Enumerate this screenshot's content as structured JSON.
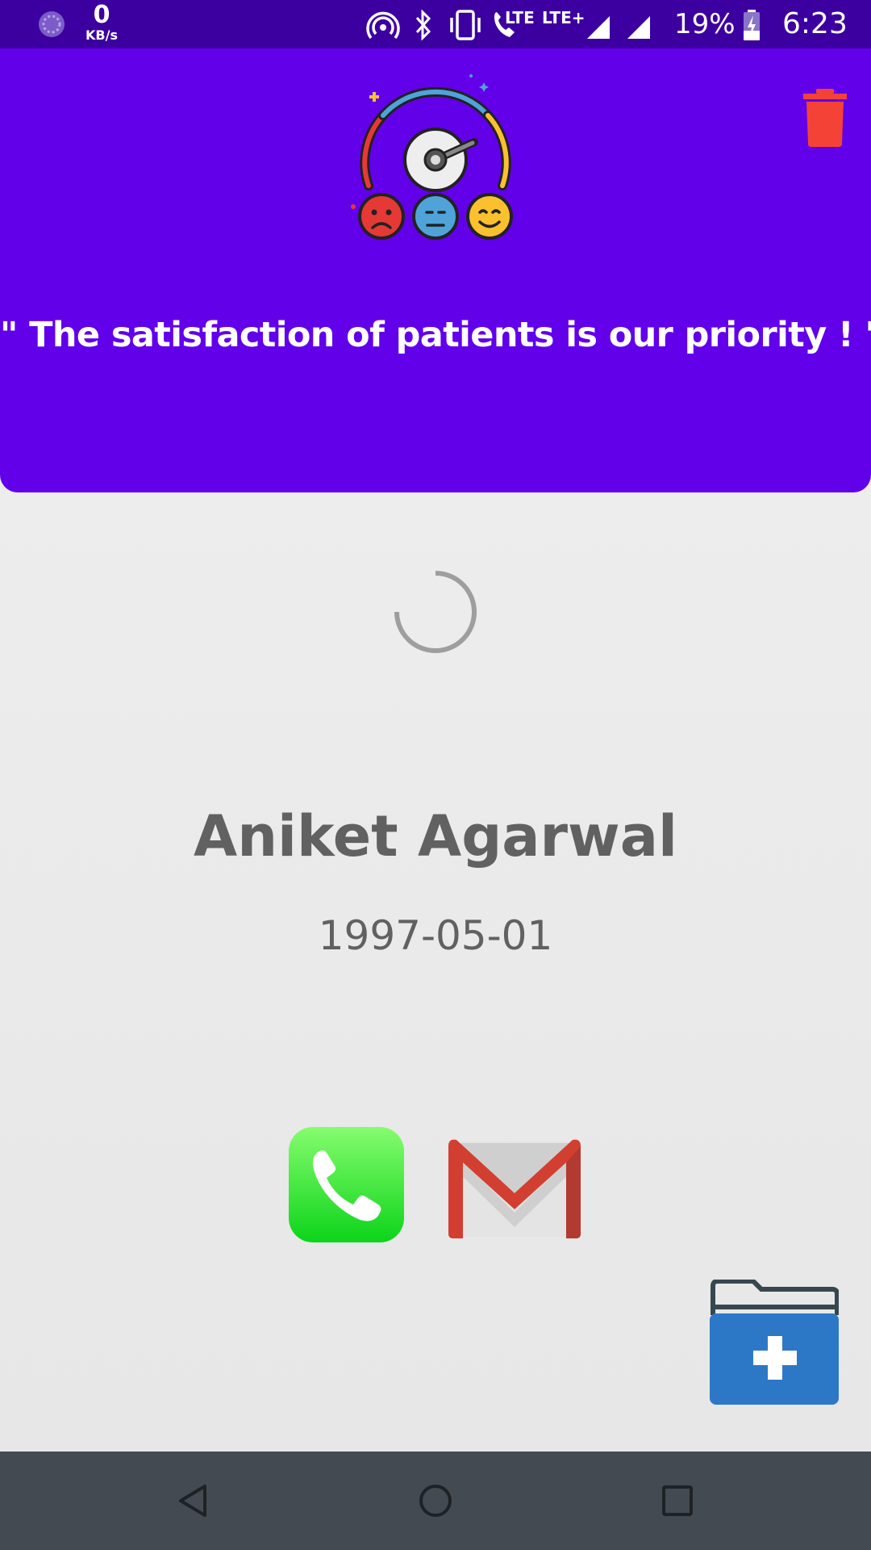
{
  "status_bar": {
    "data_speed_value": "0",
    "data_speed_unit": "KB/s",
    "network_label_1": "LTE",
    "network_label_2": "LTE+",
    "battery_percent": "19%",
    "time": "6:23"
  },
  "header": {
    "tagline": "\" The satisfaction of patients is our priority ! \"",
    "background_color": "#6200ea",
    "logo_icon": "satisfaction-meter-icon",
    "delete_icon": "trash-icon"
  },
  "patient": {
    "name": "Aniket Agarwal",
    "dob": "1997-05-01"
  },
  "actions": {
    "call_icon": "phone-icon",
    "email_icon": "gmail-icon",
    "records_icon": "medical-folder-icon"
  },
  "nav_bar": {
    "back_icon": "back-triangle-icon",
    "home_icon": "home-circle-icon",
    "recents_icon": "recents-square-icon"
  }
}
